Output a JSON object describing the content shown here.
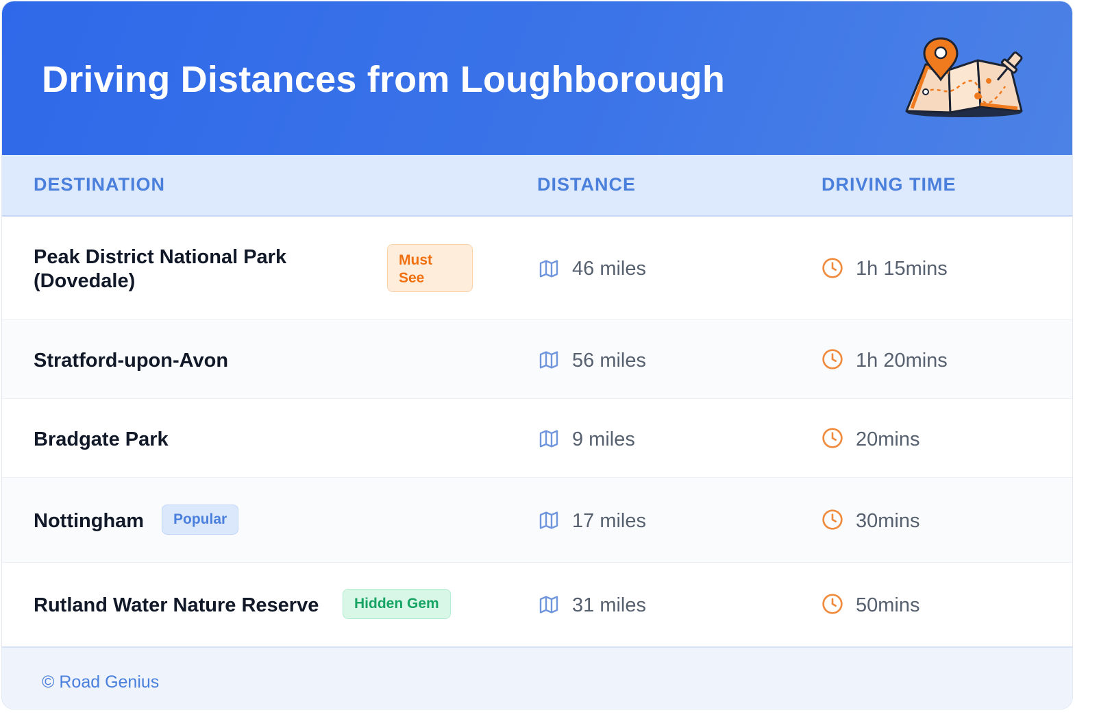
{
  "header": {
    "title": "Driving Distances from Loughborough",
    "illustration_icon": "folded-map-with-pin-icon"
  },
  "table": {
    "columns": [
      "DESTINATION",
      "DISTANCE",
      "DRIVING TIME"
    ],
    "distance_icon": "map-icon",
    "time_icon": "clock-icon",
    "rows": [
      {
        "destination": "Peak District National Park (Dovedale)",
        "badge": "Must See",
        "badge_color": "#f06f0f",
        "distance": "46 miles",
        "time": "1h 15mins"
      },
      {
        "destination": "Stratford-upon-Avon",
        "badge": "",
        "distance": "56 miles",
        "time": "1h 20mins"
      },
      {
        "destination": "Bradgate Park",
        "badge": "",
        "distance": "9 miles",
        "time": "20mins"
      },
      {
        "destination": "Nottingham",
        "badge": "Popular",
        "badge_color": "#4a7fdc",
        "distance": "17 miles",
        "time": "30mins"
      },
      {
        "destination": "Rutland Water Nature Reserve",
        "badge": "Hidden Gem",
        "badge_color": "#17a464",
        "distance": "31 miles",
        "time": "50mins"
      }
    ]
  },
  "footer": {
    "credit": "© Road Genius"
  },
  "colors": {
    "header_gradient_start": "#2f69e9",
    "header_gradient_end": "#4c82e6",
    "accent_blue": "#4a7fdc",
    "clock_orange": "#f08a3c"
  }
}
